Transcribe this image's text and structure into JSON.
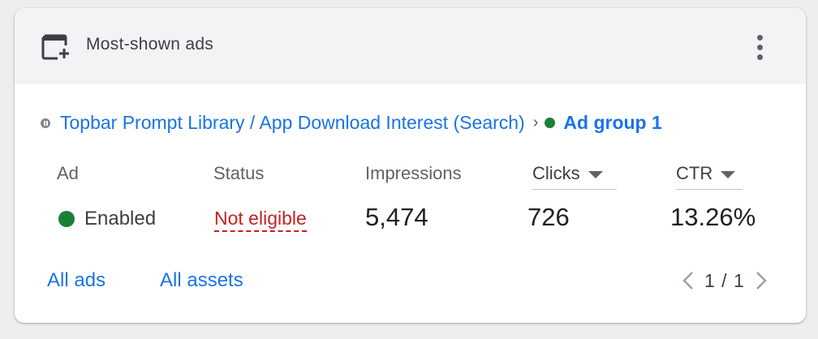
{
  "card": {
    "title": "Most-shown ads",
    "header_icon": "add-to-window-icon",
    "menu_icon": "more-vert-icon"
  },
  "breadcrumb": {
    "status_icon": "paused-icon",
    "campaign": "Topbar Prompt Library / App Download Interest (Search)",
    "separator": "›",
    "ad_group_status_color": "#188038",
    "ad_group": "Ad group 1"
  },
  "table": {
    "headers": {
      "ad": "Ad",
      "status": "Status",
      "impressions": "Impressions",
      "clicks": "Clicks",
      "ctr": "CTR"
    },
    "row": {
      "ad_status": "Enabled",
      "ad_status_color": "#188038",
      "status": "Not eligible",
      "status_color": "#c5221f",
      "impressions": "5,474",
      "clicks": "726",
      "ctr": "13.26%"
    }
  },
  "footer": {
    "all_ads": "All ads",
    "all_assets": "All assets",
    "pagination": "1 / 1"
  },
  "colors": {
    "link": "#1a73e8",
    "header_bg": "#f1f3f4"
  }
}
